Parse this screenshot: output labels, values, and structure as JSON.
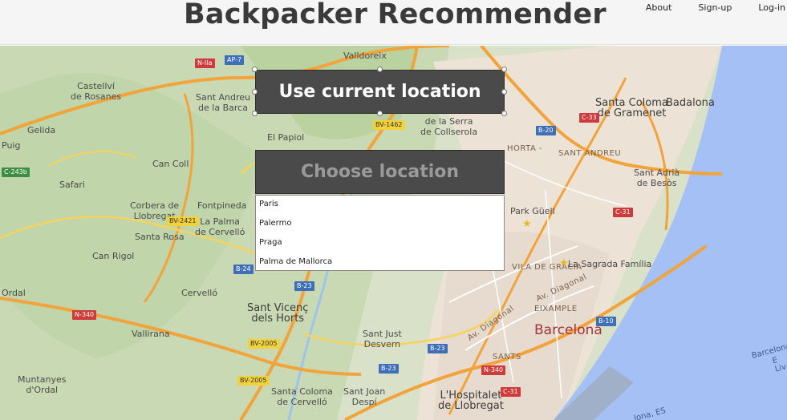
{
  "header": {
    "title": "Backpacker Recommender",
    "nav": [
      "About",
      "Sign-up",
      "Log-in"
    ]
  },
  "actions": {
    "current_location": "Use current location",
    "choose_location": "Choose location"
  },
  "dropdown": {
    "options": [
      "Paris",
      "Palermo",
      "Praga",
      "Palma de Mallorca"
    ]
  },
  "map": {
    "places": {
      "valldoreix": "Valldoreix",
      "castellvi": "Castellví\nde Rosanes",
      "sant_andreu_barca": "Sant Andreu\nde la Barca",
      "gelida": "Gelida",
      "puig": "Puig",
      "el_papiol": "El Papiol",
      "la_serra": "de la Serra\nde Collserola",
      "can_coll": "Can Coll",
      "safari": "Safari",
      "corbera": "Corbera de\nLlobregat",
      "fontpineda": "Fontpineda",
      "la_palma": "La Palma\nde Cervelló",
      "santa_rosa": "Santa Rosa",
      "can_rigol": "Can Rigol",
      "ordal": "Ordal",
      "cervello": "Cervelló",
      "vallirana": "Vallirana",
      "sant_vicenc": "Sant Vicenç\ndels Horts",
      "sant_just": "Sant Just\nDesvern",
      "muntanyes": "Muntanyes\nd'Ordal",
      "santa_coloma_cervello": "Santa Coloma\nde Cervelló",
      "sant_joan_despi": "Sant Joan\nDespí",
      "hospitalet": "L'Hospitalet\nde Llobregat",
      "santa_coloma_gramenet": "Santa Coloma\nde Gramenet",
      "badalona": "Badalona",
      "sant_andreu": "SANT ANDREU",
      "horta": "HORTA -",
      "sant_adria": "Sant Adrià\nde Besòs",
      "park_guell": "Park Güell",
      "vila_gracia": "VILA DE GRÀCIA",
      "sagrada_familia": "La Sagrada Família",
      "av_diagonal_1": "Av. Diagonal",
      "av_diagonal_2": "Av. Diagonal",
      "eixample": "EIXAMPLE",
      "sants": "SANTS",
      "barcelona": "Barcelona",
      "sea_1": "Barcelona, E",
      "sea_2": "Liv",
      "sea_3": "lona, ES"
    },
    "roads": {
      "n2a": "N-IIa",
      "ap7": "AP-7",
      "bv1462": "BV-1462",
      "b20": "B-20",
      "c33": "C-33",
      "c243b": "C-243b",
      "bv2421": "BV-2421",
      "b24": "B-24",
      "b23": "B-23",
      "c31_a": "C-31",
      "n340_a": "N-340",
      "bv2005_a": "BV-2005",
      "bv2005_b": "BV-2005",
      "b23_b": "B-23",
      "b23_c": "B-23",
      "n340_b": "N-340",
      "c31_b": "C-31",
      "b10": "B-10"
    }
  }
}
